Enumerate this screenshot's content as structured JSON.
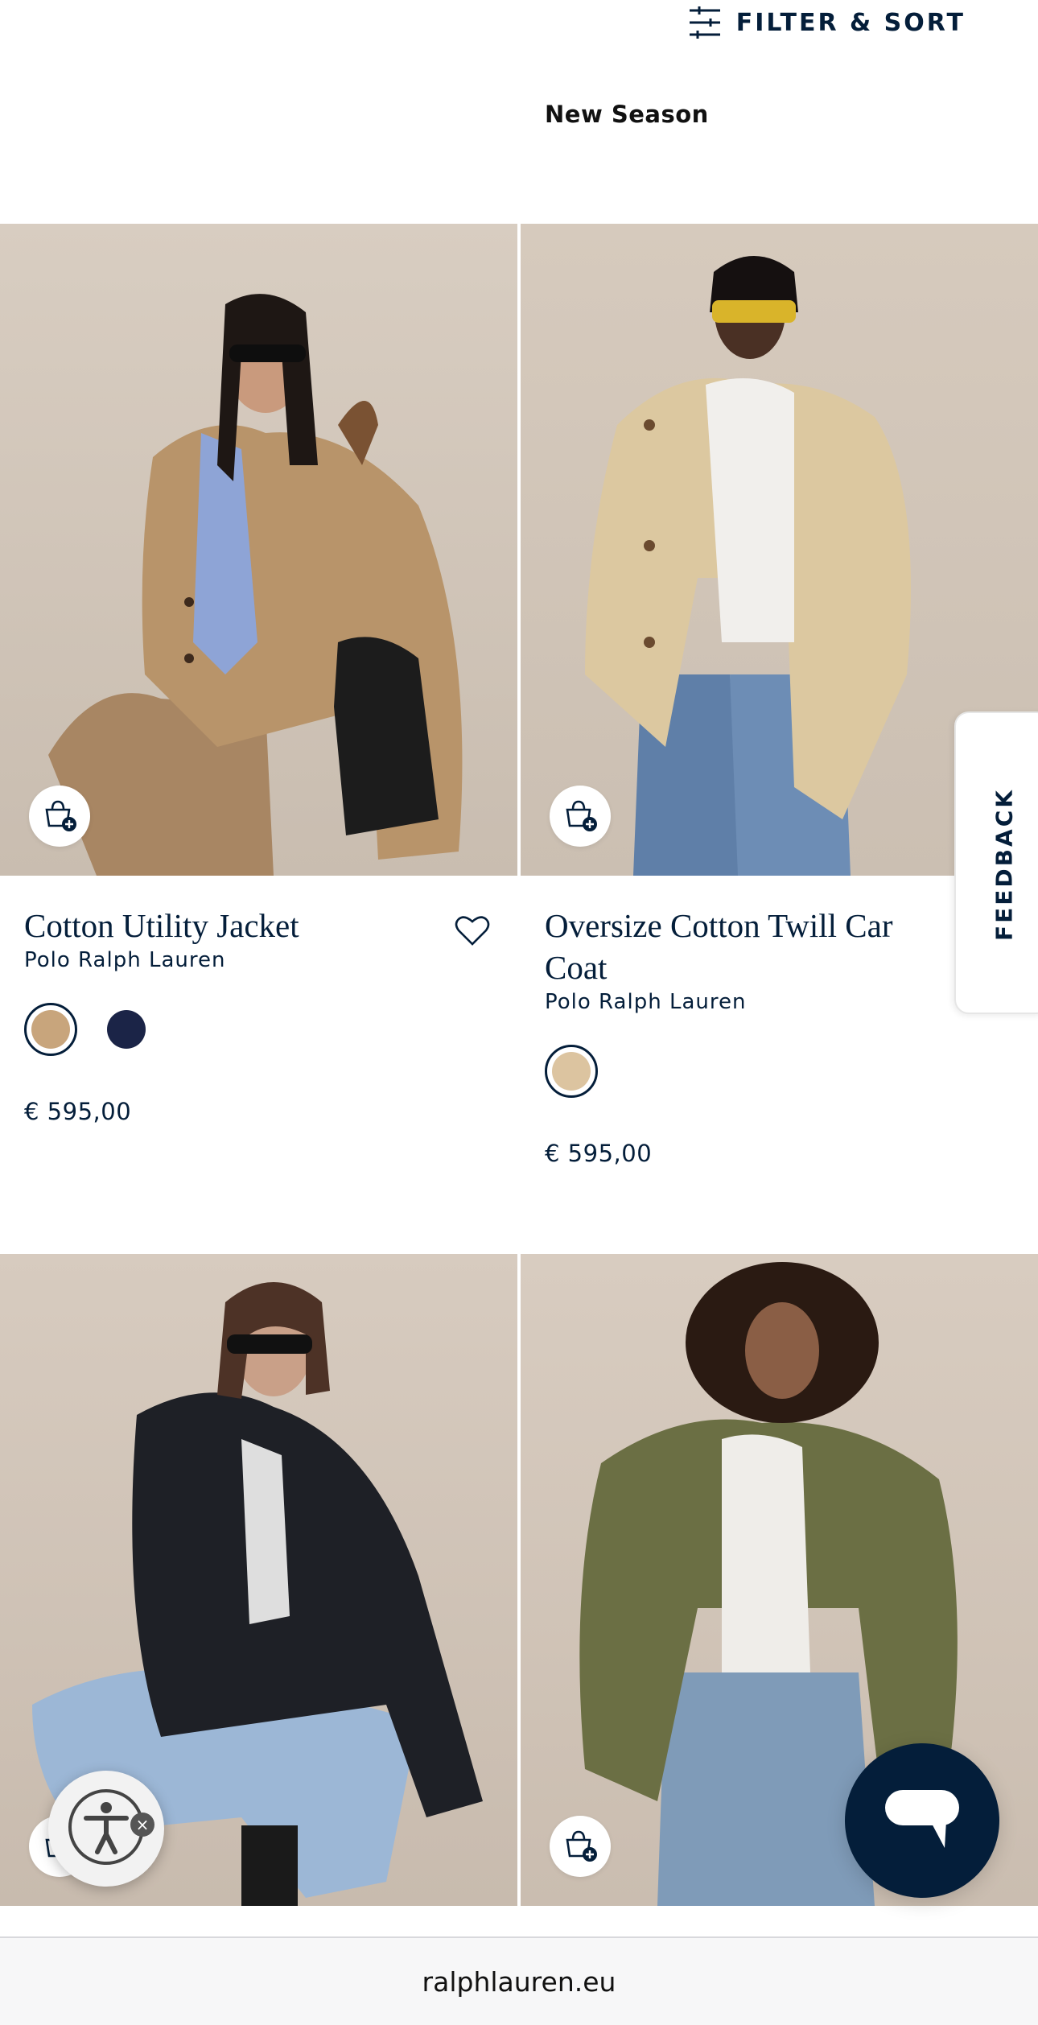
{
  "toolbar": {
    "filter_label": "FILTER & SORT",
    "filter_icon": "sliders-icon"
  },
  "collection": {
    "label": "New Season"
  },
  "products": [
    {
      "name": "Cotton Utility Jacket",
      "brand": "Polo Ralph Lauren",
      "price": "€ 595,00",
      "swatches": [
        {
          "color": "#c8a57c",
          "selected": true
        },
        {
          "color": "#1b2447",
          "selected": false
        }
      ],
      "wishlist_icon": "heart-icon",
      "quick_add_icon": "shopping-bag-plus-icon"
    },
    {
      "name": "Oversize Cotton Twill Car Coat",
      "brand": "Polo Ralph Lauren",
      "price": "€ 595,00",
      "swatches": [
        {
          "color": "#dcc4a0",
          "selected": true
        }
      ],
      "quick_add_icon": "shopping-bag-plus-icon"
    },
    {
      "quick_add_icon": "shopping-bag-plus-icon"
    },
    {
      "quick_add_icon": "shopping-bag-plus-icon"
    }
  ],
  "feedback": {
    "label": "FEEDBACK"
  },
  "chat": {
    "icon": "chat-bubble-icon"
  },
  "accessibility": {
    "icon": "accessibility-person-icon",
    "close_symbol": "×"
  },
  "browser": {
    "url": "ralphlauren.eu"
  },
  "colors": {
    "navy": "#041e3a",
    "backdrop": "#d9cfc4"
  }
}
